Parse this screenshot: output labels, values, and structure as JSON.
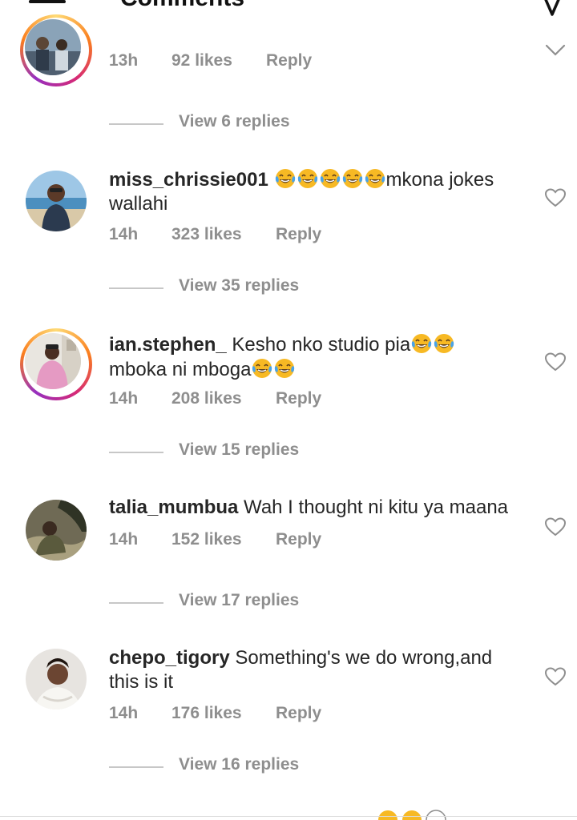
{
  "header": {
    "title": "Comments"
  },
  "top_comment": {
    "time": "13h",
    "likes": "92 likes",
    "reply": "Reply",
    "view_replies": "View 6 replies"
  },
  "comments": [
    {
      "username": "miss_chrissie001",
      "text_before": " ",
      "emoji_count": 5,
      "text_after": "mkona jokes wallahi",
      "time": "14h",
      "likes": "323 likes",
      "reply": "Reply",
      "view_replies": "View 35 replies"
    },
    {
      "username": "ian.stephen_",
      "text_line1": " Kesho nko studio pia",
      "text_line2": "mboka ni mboga",
      "time": "14h",
      "likes": "208 likes",
      "reply": "Reply",
      "view_replies": "View 15 replies"
    },
    {
      "username": "talia_mumbua",
      "text": " Wah I thought ni kitu ya maana",
      "time": "14h",
      "likes": "152 likes",
      "reply": "Reply",
      "view_replies": "View 17 replies"
    },
    {
      "username": "chepo_tigory",
      "text": " Something's we do wrong,and this is it",
      "time": "14h",
      "likes": "176 likes",
      "reply": "Reply",
      "view_replies": "View 16 replies"
    }
  ],
  "colors": {
    "story_ring": [
      "#feda75",
      "#fa7e1e",
      "#d62976",
      "#962fbf"
    ],
    "meta_text": "#8e8e8e",
    "body_text": "#262626"
  },
  "icons": [
    "back-arrow-icon",
    "send-icon",
    "chevron-down-icon",
    "heart-icon",
    "laughing-emoji-icon"
  ]
}
